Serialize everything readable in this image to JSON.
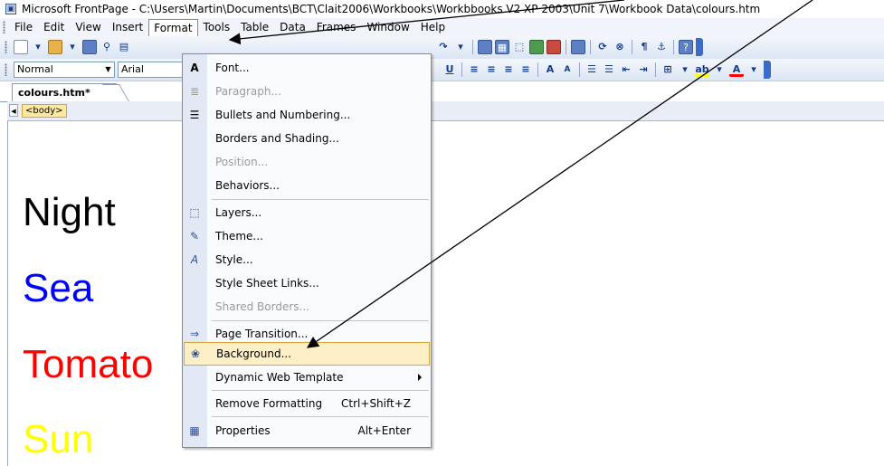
{
  "window": {
    "title": "Microsoft FrontPage - C:\\Users\\Martin\\Documents\\BCT\\Clait2006\\Workbooks\\Workbbooks V2 XP 2003\\Unit 7\\Workbook Data\\colours.htm",
    "icon": "frontpage-icon"
  },
  "menubar": {
    "items": [
      "File",
      "Edit",
      "View",
      "Insert",
      "Format",
      "Tools",
      "Table",
      "Data",
      "Frames",
      "Window",
      "Help"
    ],
    "active": "Format"
  },
  "formatting_toolbar": {
    "style_value": "Normal",
    "font_value": "Arial"
  },
  "document": {
    "tab_label": "colours.htm*",
    "quick_tag": "<body>",
    "words": [
      {
        "text": "Night",
        "color": "#000000"
      },
      {
        "text": "Sea",
        "color": "#0000ff"
      },
      {
        "text": "Tomato",
        "color": "#ff0000"
      },
      {
        "text": "Sun",
        "color": "#ffff00"
      }
    ]
  },
  "format_menu": {
    "items": [
      {
        "label": "Font...",
        "icon": "font-icon"
      },
      {
        "label": "Paragraph...",
        "icon": "paragraph-icon",
        "disabled": true
      },
      {
        "label": "Bullets and Numbering...",
        "icon": "bullets-icon"
      },
      {
        "label": "Borders and Shading..."
      },
      {
        "label": "Position...",
        "disabled": true
      },
      {
        "label": "Behaviors..."
      },
      {
        "label": "Layers...",
        "icon": "layers-icon"
      },
      {
        "label": "Theme...",
        "icon": "theme-icon"
      },
      {
        "label": "Style...",
        "icon": "style-icon"
      },
      {
        "label": "Style Sheet Links..."
      },
      {
        "label": "Shared Borders...",
        "disabled": true
      },
      {
        "label": "Page Transition...",
        "icon": "page-transition-icon"
      },
      {
        "label": "Background...",
        "icon": "background-icon",
        "highlighted": true
      },
      {
        "label": "Dynamic Web Template",
        "submenu": true
      },
      {
        "label": "Remove Formatting",
        "shortcut": "Ctrl+Shift+Z"
      },
      {
        "label": "Properties",
        "shortcut": "Alt+Enter",
        "icon": "properties-icon"
      }
    ]
  },
  "colors": {
    "menu_highlight": "#fdefc6",
    "toolbar": "#dbe5f4"
  }
}
